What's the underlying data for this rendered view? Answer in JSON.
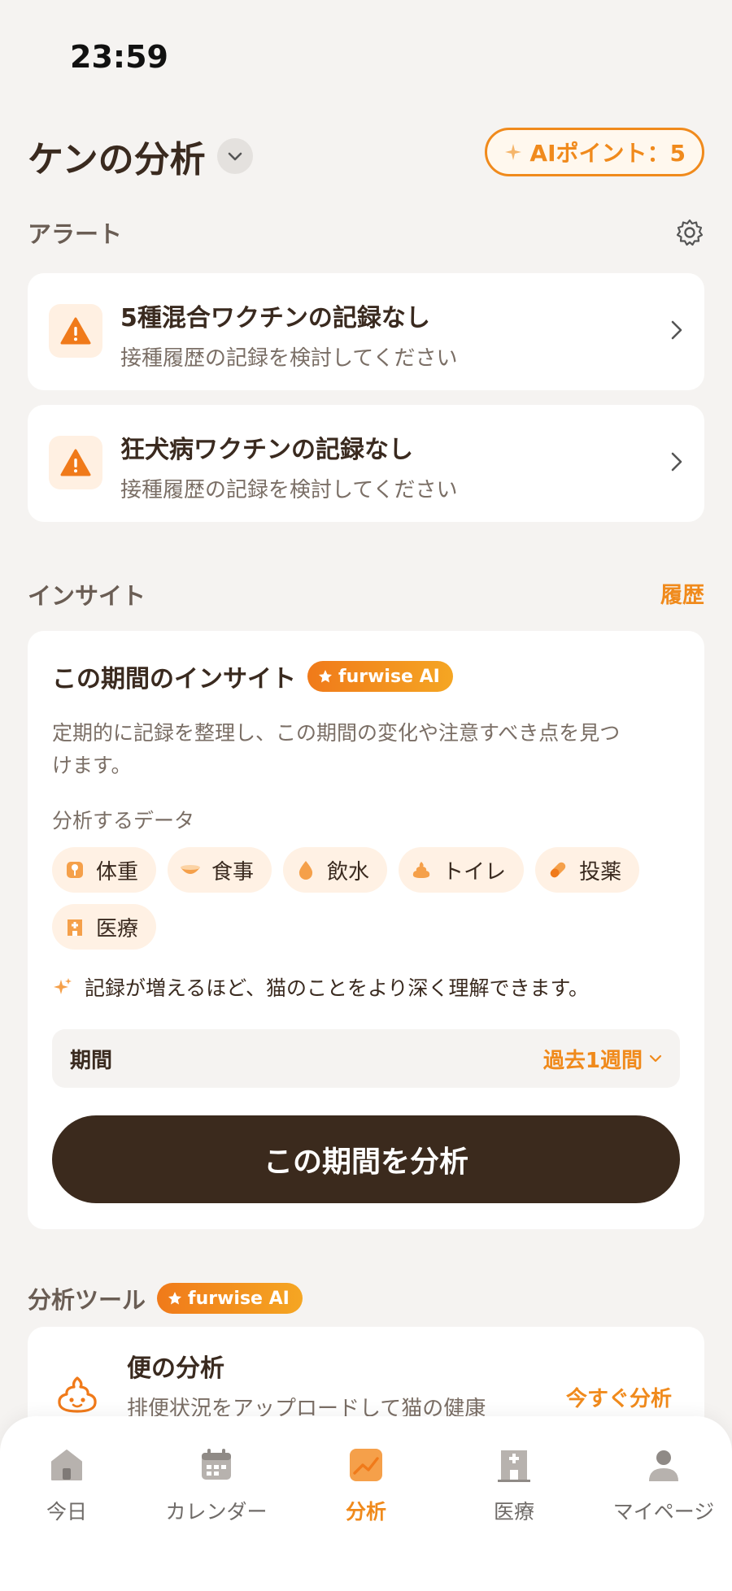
{
  "status_bar": {
    "time": "23:59"
  },
  "header": {
    "title": "ケンの分析",
    "ai_points_label": "AIポイント：5"
  },
  "alerts": {
    "section_label": "アラート",
    "items": [
      {
        "title": "5種混合ワクチンの記録なし",
        "subtitle": "接種履歴の記録を検討してください"
      },
      {
        "title": "狂犬病ワクチンの記録なし",
        "subtitle": "接種履歴の記録を検討してください"
      }
    ]
  },
  "insight": {
    "section_label": "インサイト",
    "history_link": "履歴",
    "card_title": "この期間のインサイト",
    "ai_badge": "furwise AI",
    "description": "定期的に記録を整理し、この期間の変化や注意すべき点を見つけます。",
    "data_label": "分析するデータ",
    "chips": [
      "体重",
      "食事",
      "飲水",
      "トイレ",
      "投薬",
      "医療"
    ],
    "tip": "記録が増えるほど、猫のことをより深く理解できます。",
    "period_label": "期間",
    "period_value": "過去1週間",
    "analyze_button": "この期間を分析"
  },
  "tools": {
    "section_label": "分析ツール",
    "ai_badge": "furwise AI",
    "item": {
      "title": "便の分析",
      "subtitle": "排便状況をアップロードして猫の健康",
      "cta": "今すぐ分析"
    }
  },
  "nav": {
    "items": [
      {
        "label": "今日",
        "icon": "home-icon"
      },
      {
        "label": "カレンダー",
        "icon": "calendar-icon"
      },
      {
        "label": "分析",
        "icon": "chart-icon"
      },
      {
        "label": "医療",
        "icon": "hospital-icon"
      },
      {
        "label": "マイページ",
        "icon": "person-icon"
      }
    ],
    "active": "分析"
  },
  "colors": {
    "accent": "#f08a1c",
    "dark_button": "#3b2a1d",
    "background": "#f5f3f1"
  }
}
